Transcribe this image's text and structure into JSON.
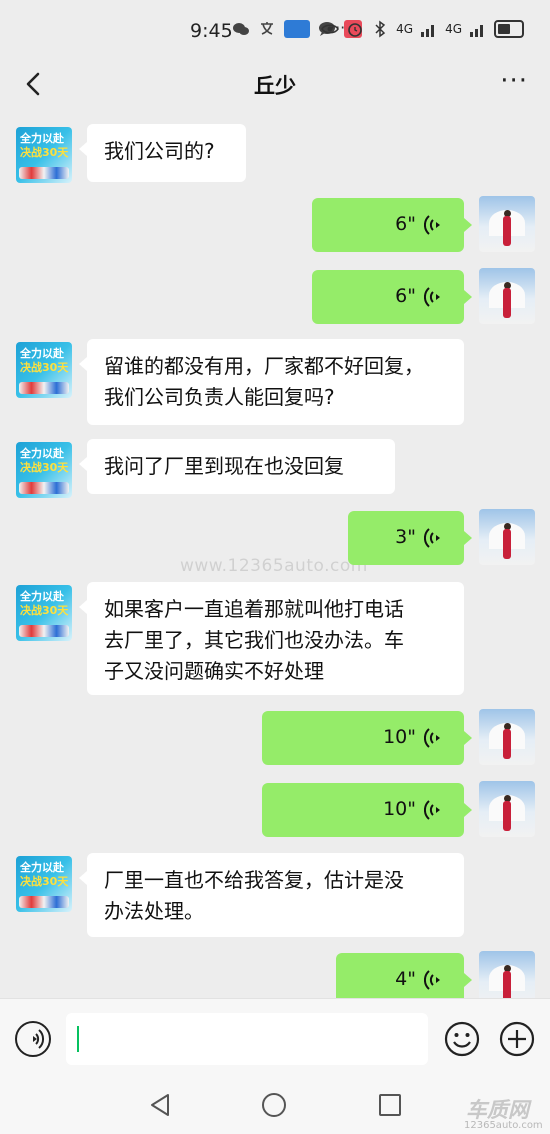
{
  "status_bar": {
    "time": "9:45",
    "dots": "···",
    "signal_label_1": "4G",
    "signal_label_2": "4G"
  },
  "header": {
    "title": "丘少",
    "back_icon": "chevron-left-icon",
    "more_icon": "more-dots-icon",
    "more_label": "···"
  },
  "contact_avatar": {
    "line1": "全力以赴",
    "line2_prefix": "决战",
    "line2_number": "30",
    "line2_suffix": "天"
  },
  "messages": [
    {
      "side": "left",
      "type": "text",
      "text": "我们公司的?"
    },
    {
      "side": "right",
      "type": "voice",
      "duration": "6\""
    },
    {
      "side": "right",
      "type": "voice",
      "duration": "6\""
    },
    {
      "side": "left",
      "type": "text",
      "lines": [
        "留谁的都没有用，厂家都不好回复，",
        "我们公司负责人能回复吗?"
      ]
    },
    {
      "side": "left",
      "type": "text",
      "text": "我问了厂里到现在也没回复"
    },
    {
      "side": "right",
      "type": "voice",
      "duration": "3\""
    },
    {
      "side": "left",
      "type": "text",
      "lines": [
        "如果客户一直追着那就叫他打电话",
        "去厂里了，其它我们也没办法。车",
        "子又没问题确实不好处理"
      ]
    },
    {
      "side": "right",
      "type": "voice",
      "duration": "10\""
    },
    {
      "side": "right",
      "type": "voice",
      "duration": "10\""
    },
    {
      "side": "left",
      "type": "text",
      "lines": [
        "厂里一直也不给我答复，估计是没",
        "办法处理。"
      ]
    },
    {
      "side": "right",
      "type": "voice",
      "duration": "4\""
    }
  ],
  "watermark": "www.12365auto.com",
  "input_bar": {
    "voice_icon": "voice-mode-icon",
    "input_value": "",
    "emoji_icon": "emoji-icon",
    "plus_icon": "plus-icon"
  },
  "system_nav": {
    "back_icon": "triangle-back-icon",
    "home_icon": "circle-home-icon",
    "recent_icon": "square-recent-icon"
  },
  "brand": {
    "logo_text": "车质网",
    "url": "12365auto.com"
  },
  "colors": {
    "chat_background": "#ededed",
    "sent_bubble": "#95ec69",
    "received_bubble": "#ffffff",
    "caret": "#07c160"
  }
}
